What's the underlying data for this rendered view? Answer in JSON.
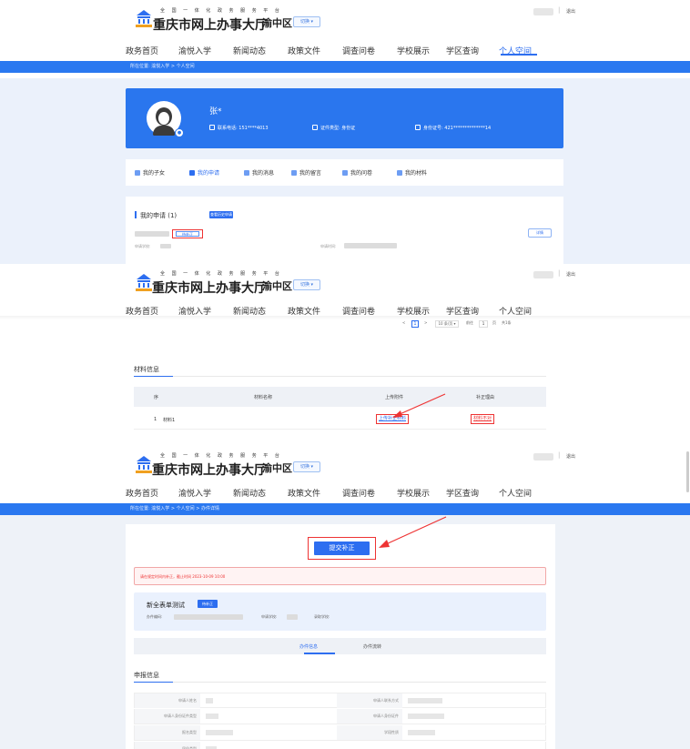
{
  "header": {
    "subtitle": "全 国 一 体 化 政 务 服 务 平 台",
    "title": "重庆市网上办事大厅",
    "district": "渝中区",
    "switch_label": "切换",
    "separator": "|",
    "logout_label": "退出"
  },
  "nav": {
    "items": [
      "政务首页",
      "渝悦入学",
      "新闻动态",
      "政策文件",
      "调查问卷",
      "学校展示",
      "学区查询",
      "个人空间"
    ],
    "active_index": 7
  },
  "breadcrumb1": "所在位置:  渝悦入学 > 个人空间",
  "breadcrumb3": "所在位置:  渝悦入学 > 个人空间 > 办件详情",
  "profile": {
    "name": "张*",
    "phone": "联系电话: 151****4013",
    "id_type": "证件类型: 身份证",
    "id_no": "身份证号: 421**************14"
  },
  "profile_tabs": {
    "items": [
      "我的子女",
      "我的申请",
      "我的消息",
      "我的留言",
      "我的问卷",
      "我的材料"
    ],
    "active_index": 1
  },
  "apply": {
    "title": "我的申请",
    "count": "(1)",
    "history_btn": "查看历史申请",
    "status": "待补正",
    "school_label": "申请学校:",
    "time_label": "申请时间:",
    "detail_btn": "详情"
  },
  "pager": {
    "prev": "<",
    "page": "1",
    "next": ">",
    "page_size": "10 条/页",
    "goto_label": "前往",
    "goto_value": "1",
    "page_unit": "页",
    "total": "共1条"
  },
  "materials": {
    "title": "材料信息",
    "headers": [
      "序",
      "材料名称",
      "上传附件",
      "补正理由"
    ],
    "rows": [
      {
        "no": "1",
        "name": "材料1",
        "upload": "上传补正材料",
        "reason": "材料不对"
      }
    ]
  },
  "submit_label": "提交补正",
  "alert_text": "请在规定时间内补正，截止时间 2023-10-09 10:00",
  "form_card": {
    "title": "新全表单测试",
    "tag": "待补正",
    "code_label": "办件编码:",
    "school_label": "申请学校:",
    "admit_label": "录取学校:"
  },
  "detail_tabs": [
    "办件信息",
    "办件流转"
  ],
  "declare": {
    "title": "申报信息",
    "left_labels": [
      "申请人姓名",
      "申请人身份证件类型",
      "报名类型",
      "居住类型"
    ],
    "right_labels": [
      "申请人联系方式",
      "申请人身份证件",
      "学段性质"
    ]
  },
  "colors": {
    "primary": "#2d6ef0",
    "banner": "#2a76ee",
    "highlight": "#e33333",
    "page_bg": "#ebf1fb"
  }
}
